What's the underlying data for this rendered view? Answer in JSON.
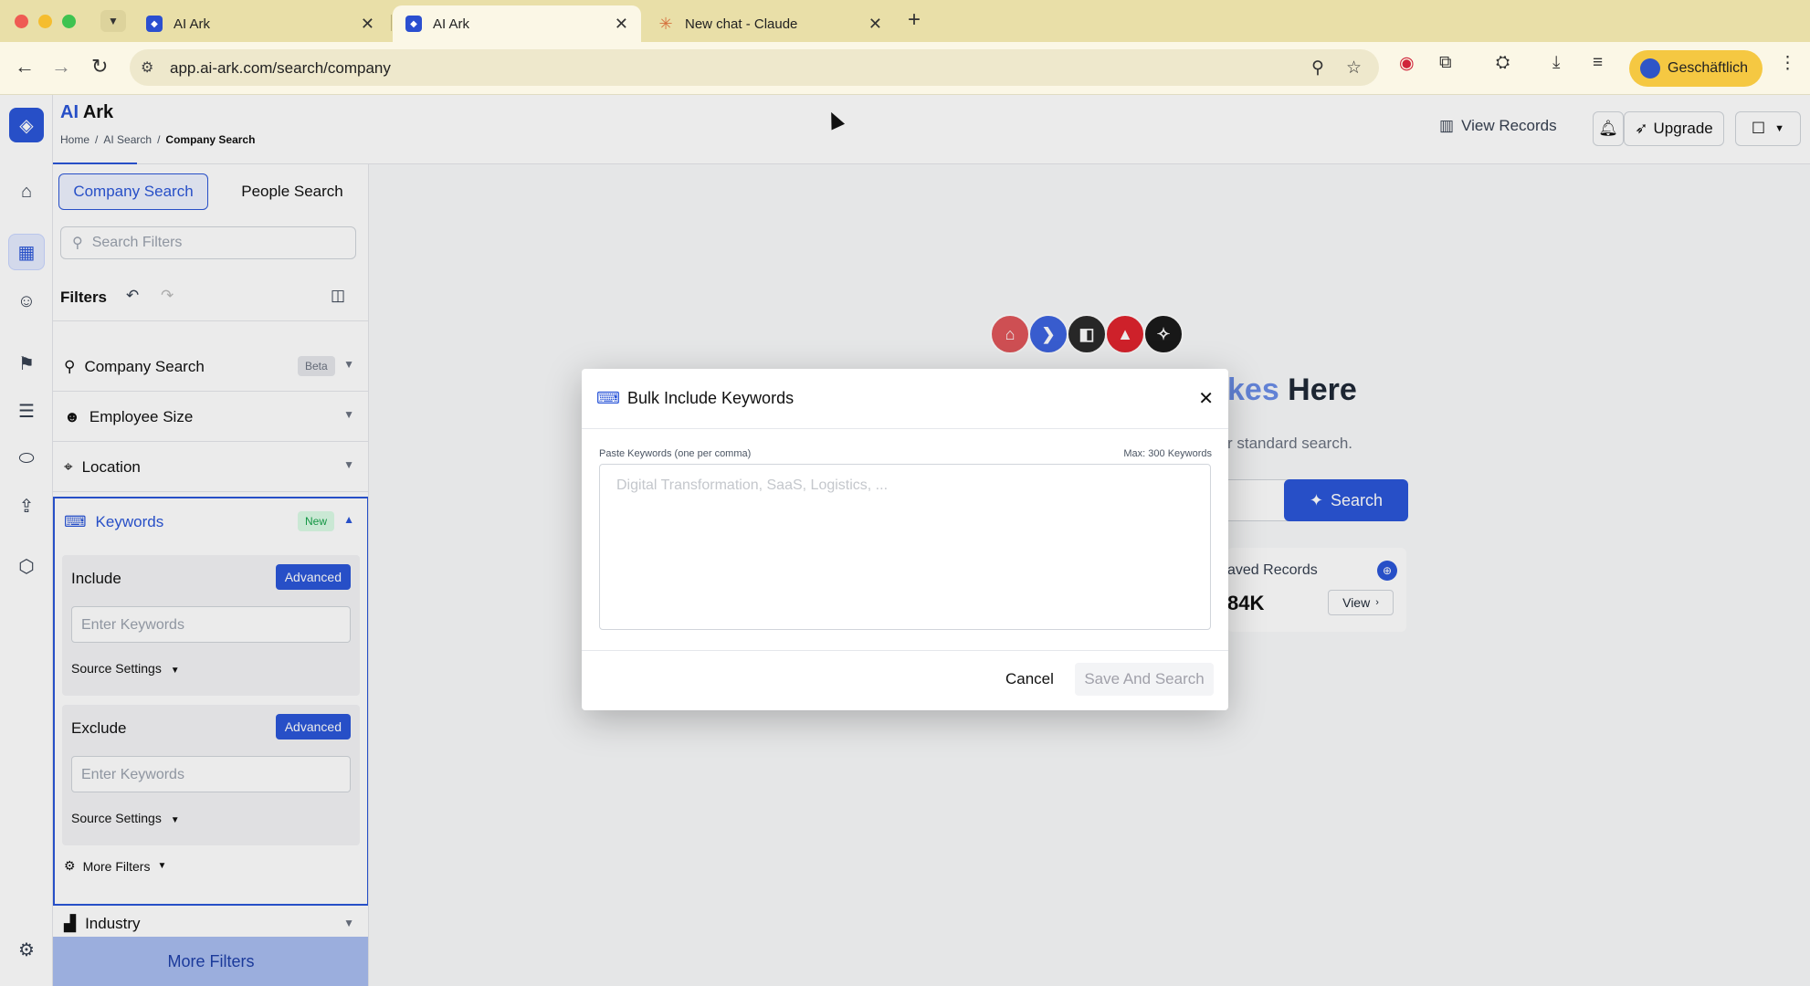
{
  "browser": {
    "tabs": [
      {
        "title": "AI Ark",
        "active": false
      },
      {
        "title": "AI Ark",
        "active": true
      },
      {
        "title": "New chat - Claude",
        "active": false
      }
    ],
    "url": "app.ai-ark.com/search/company",
    "profile_label": "Geschäftlich"
  },
  "header": {
    "brand_prefix": "AI",
    "brand_suffix": "Ark",
    "breadcrumb": [
      "Home",
      "AI Search",
      "Company Search"
    ],
    "view_records": "View Records",
    "upgrade": "Upgrade"
  },
  "sidebar": {
    "tab_company": "Company Search",
    "tab_people": "People Search",
    "search_placeholder": "Search Filters",
    "filters_title": "Filters",
    "rows": [
      {
        "label": "Company Search",
        "badge": "Beta"
      },
      {
        "label": "Employee Size"
      },
      {
        "label": "Location"
      }
    ],
    "keywords": {
      "label": "Keywords",
      "badge": "New",
      "include_title": "Include",
      "exclude_title": "Exclude",
      "advanced": "Advanced",
      "input_placeholder": "Enter Keywords",
      "source_settings": "Source Settings",
      "more_filters_link": "More Filters"
    },
    "industry": "Industry",
    "more_filters_button": "More Filters"
  },
  "main": {
    "hero_highlight": "kes",
    "hero_rest": " Here",
    "hero_sub": "r standard search.",
    "search_button": "Search",
    "saved_title": "aved Records",
    "saved_count": "84K",
    "view_button": "View"
  },
  "modal": {
    "title": "Bulk Include Keywords",
    "field_label": "Paste Keywords (one per comma)",
    "max_label": "Max: 300 Keywords",
    "placeholder": "Digital Transformation, SaaS, Logistics, ...",
    "cancel": "Cancel",
    "save": "Save And Search"
  },
  "colors": {
    "primary": "#2b56d8",
    "tabbar": "#e9dfa8",
    "profile": "#f5c842"
  }
}
